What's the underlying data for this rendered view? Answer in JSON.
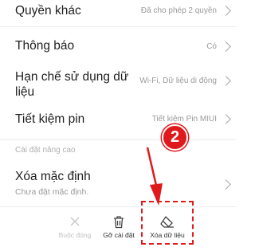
{
  "settings": {
    "other_permissions": {
      "label": "Quyền khác",
      "value": "Đã cho phép 2 quyền"
    },
    "notifications": {
      "label": "Thông báo",
      "value": "Có"
    },
    "data_restriction": {
      "label": "Hạn chế sử dụng dữ liệu",
      "value": "Wi-Fi, Dữ liệu di động"
    },
    "battery_saver": {
      "label": "Tiết kiệm pin",
      "value": "Tiết kiệm Pin MIUI"
    },
    "advanced_header": "Cài đặt nâng cao",
    "clear_defaults": {
      "label": "Xóa mặc định",
      "sub": "Chưa đặt mặc định."
    }
  },
  "toolbar": {
    "force_stop": "Buộc đóng",
    "uninstall": "Gỡ cài đặt",
    "clear_data": "Xóa dữ liệu"
  },
  "annotation": {
    "step": "2",
    "color": "#e0191c"
  },
  "icons": {
    "force_stop": "close-icon",
    "uninstall": "trash-icon",
    "clear_data": "eraser-icon",
    "row": "chevron-right-icon"
  }
}
